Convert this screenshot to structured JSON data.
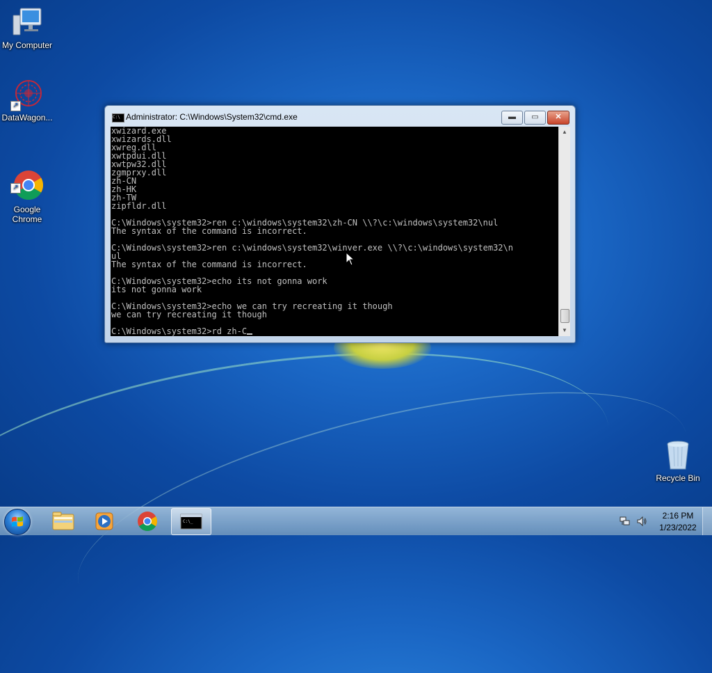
{
  "desktop": {
    "icons": [
      {
        "label": "My Computer"
      },
      {
        "label": "DataWagon..."
      },
      {
        "label": "Google\nChrome"
      },
      {
        "label": "Recycle Bin"
      }
    ]
  },
  "cmd_window": {
    "title": "Administrator: C:\\Windows\\System32\\cmd.exe",
    "buttons": {
      "minimize": "▬",
      "maximize": "▭",
      "close": "✕"
    },
    "lines": [
      "xwizard.exe",
      "xwizards.dll",
      "xwreg.dll",
      "xwtpdui.dll",
      "xwtpw32.dll",
      "zgmprxy.dll",
      "zh-CN",
      "zh-HK",
      "zh-TW",
      "zipfldr.dll",
      "",
      "C:\\Windows\\system32>ren c:\\windows\\system32\\zh-CN \\\\?\\c:\\windows\\system32\\nul",
      "The syntax of the command is incorrect.",
      "",
      "C:\\Windows\\system32>ren c:\\windows\\system32\\winver.exe \\\\?\\c:\\windows\\system32\\n",
      "ul",
      "The syntax of the command is incorrect.",
      "",
      "C:\\Windows\\system32>echo its not gonna work",
      "its not gonna work",
      "",
      "C:\\Windows\\system32>echo we can try recreating it though",
      "we can try recreating it though",
      ""
    ],
    "prompt_line": "C:\\Windows\\system32>rd zh-C"
  },
  "taskbar": {
    "pinned": [
      {
        "icon": "explorer-icon"
      },
      {
        "icon": "media-player-icon"
      },
      {
        "icon": "chrome-icon"
      },
      {
        "icon": "cmd-icon",
        "active": true
      }
    ],
    "clock": {
      "time": "2:16 PM",
      "date": "1/23/2022"
    }
  },
  "colors": {
    "console_bg": "#000000",
    "console_text": "#c0c0c0",
    "close_button": "#c9452b"
  }
}
